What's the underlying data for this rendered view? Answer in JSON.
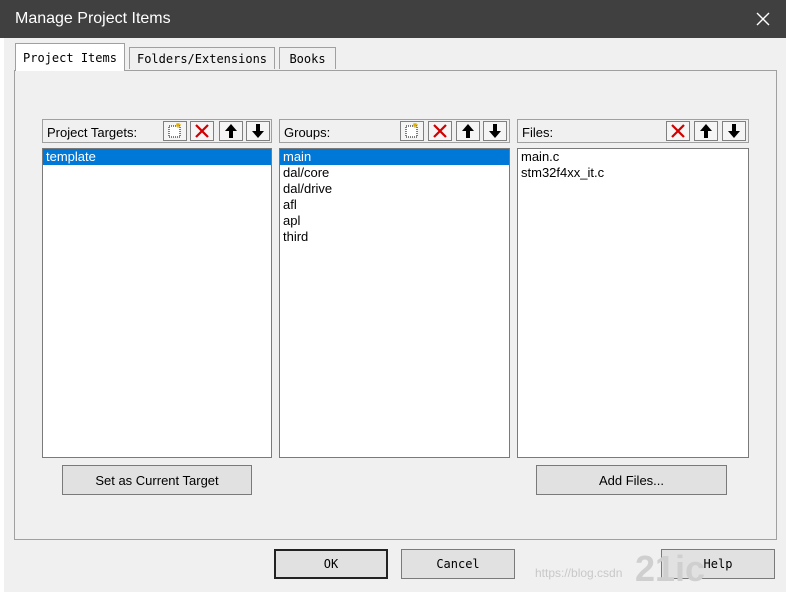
{
  "window": {
    "title": "Manage Project Items"
  },
  "tabs": [
    {
      "label": "Project Items",
      "active": true
    },
    {
      "label": "Folders/Extensions",
      "active": false
    },
    {
      "label": "Books",
      "active": false
    }
  ],
  "targets": {
    "header": "Project Targets:",
    "items": [
      "template"
    ],
    "selected": "template",
    "button": "Set as Current Target"
  },
  "groups": {
    "header": "Groups:",
    "items": [
      "main",
      "dal/core",
      "dal/drive",
      "afl",
      "apl",
      "third"
    ],
    "selected": "main"
  },
  "files": {
    "header": "Files:",
    "items": [
      "main.c",
      "stm32f4xx_it.c"
    ],
    "button": "Add Files..."
  },
  "footer": {
    "ok": "OK",
    "cancel": "Cancel",
    "help": "Help"
  },
  "watermark": {
    "text": "https://blog.csdn",
    "logo": "21ic"
  },
  "colors": {
    "titlebar": "#404040",
    "selection": "#0078d7",
    "delete": "#d00000"
  }
}
